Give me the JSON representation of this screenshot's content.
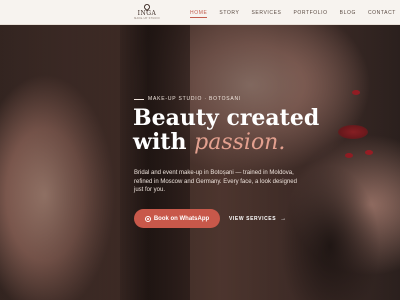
{
  "brand": {
    "name": "INGA",
    "subtitle": "MAKE-UP STUDIO"
  },
  "nav": {
    "items": [
      {
        "label": "HOME",
        "active": true
      },
      {
        "label": "STORY",
        "active": false
      },
      {
        "label": "SERVICES",
        "active": false
      },
      {
        "label": "PORTFOLIO",
        "active": false
      },
      {
        "label": "BLOG",
        "active": false
      },
      {
        "label": "CONTACT",
        "active": false
      }
    ]
  },
  "hero": {
    "eyebrow": "MAKE-UP STUDIO · BOTOSANI",
    "headline_line1": "Beauty created",
    "headline_with": "with",
    "headline_accent": "passion.",
    "description": "Bridal and event make-up in Botoșani — trained in Moldova, refined in Moscow and Germany. Every face, a look designed just for you.",
    "cta_label": "Book on WhatsApp",
    "secondary_label": "VIEW SERVICES",
    "secondary_arrow": "→"
  },
  "colors": {
    "accent": "#c8584a",
    "accent_text": "#e3a08f",
    "header_bg": "#f7f3ef"
  },
  "icons": {
    "cta": "whatsapp-icon",
    "secondary": "arrow-right-icon",
    "logo": "drop-logo-icon"
  }
}
